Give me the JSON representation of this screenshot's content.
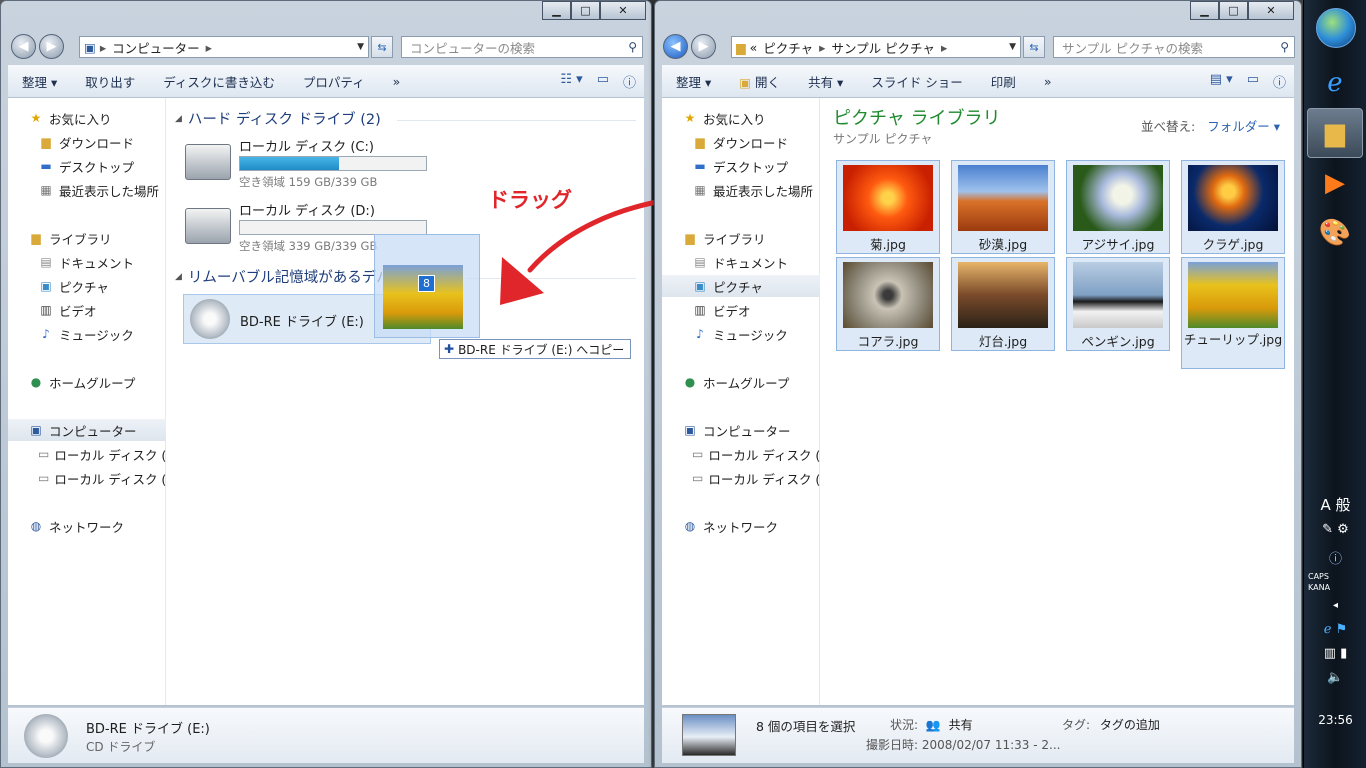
{
  "left_window": {
    "address": [
      "コンピューター"
    ],
    "search_placeholder": "コンピューターの検索",
    "toolbar": [
      "整理 ▾",
      "取り出す",
      "ディスクに書き込む",
      "プロパティ",
      "»"
    ],
    "nav": {
      "favorites": "お気に入り",
      "downloads": "ダウンロード",
      "desktop": "デスクトップ",
      "recent": "最近表示した場所",
      "libraries": "ライブラリ",
      "documents": "ドキュメント",
      "pictures": "ピクチャ",
      "videos": "ビデオ",
      "music": "ミュージック",
      "homegroup": "ホームグループ",
      "computer": "コンピューター",
      "local_c": "ローカル ディスク (",
      "local_d": "ローカル ディスク (",
      "network": "ネットワーク"
    },
    "group_hdd": "ハード ディスク ドライブ (2)",
    "drive_c": {
      "name": "ローカル ディスク (C:)",
      "free": "空き領域 159 GB/339 GB",
      "used_fraction": 0.53
    },
    "drive_d": {
      "name": "ローカル ディスク (D:)",
      "free": "空き領域 339 GB/339 GB",
      "used_fraction": 0.0
    },
    "group_removable": "リムーバブル記憶域があるデバイス (1)",
    "bd_drive": "BD-RE ドライブ (E:)",
    "drag_count": "8",
    "drag_tooltip": "BD-RE ドライブ (E:) へコピー",
    "status_name": "BD-RE ドライブ (E:)",
    "status_type": "CD ドライブ"
  },
  "annotation": "ドラッグ",
  "right_window": {
    "address_prefix": "«",
    "address": [
      "ピクチャ",
      "サンプル ピクチャ"
    ],
    "search_placeholder": "サンプル ピクチャの検索",
    "toolbar": [
      "整理 ▾",
      "開く",
      "共有 ▾",
      "スライド ショー",
      "印刷",
      "»"
    ],
    "library_title": "ピクチャ ライブラリ",
    "library_sub": "サンプル ピクチャ",
    "sort_label": "並べ替え:",
    "sort_value": "フォルダー ▾",
    "files": [
      "菊.jpg",
      "砂漠.jpg",
      "アジサイ.jpg",
      "クラゲ.jpg",
      "コアラ.jpg",
      "灯台.jpg",
      "ペンギン.jpg",
      "チューリップ.jpg"
    ],
    "status_selected": "8 個の項目を選択",
    "status_state_label": "状況:",
    "status_state_value": "共有",
    "status_tag_label": "タグ:",
    "status_tag_value": "タグの追加",
    "status_date": "撮影日時: 2008/02/07 11:33 - 2..."
  },
  "taskbar": {
    "ime_label": "般",
    "ime_a": "A",
    "caps": "CAPS",
    "kana": "KANA",
    "time": "23:56"
  }
}
